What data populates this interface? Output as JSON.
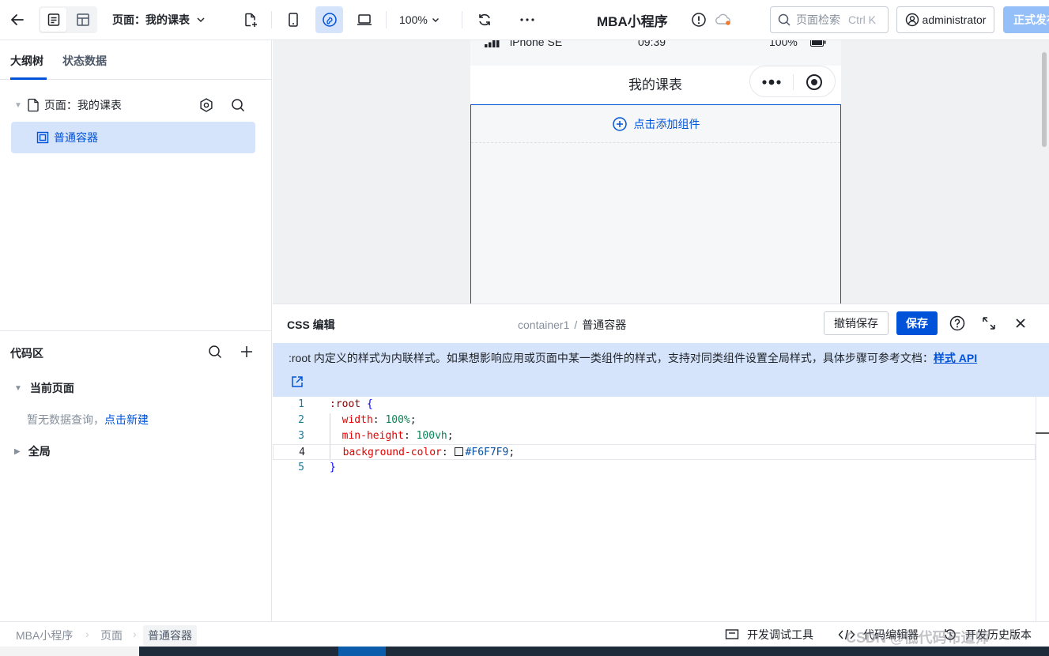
{
  "topbar": {
    "page_label": "页面：我的课表",
    "zoom": "100%",
    "app_title": "MBA小程序",
    "search_placeholder": "页面检索",
    "search_shortcut": "Ctrl K",
    "user": "administrator",
    "publish_label": "正式发布"
  },
  "left_tabs": {
    "outline": "大纲树",
    "state": "状态数据"
  },
  "tree": {
    "page_node": "页面：我的课表",
    "container_node": "普通容器"
  },
  "code_area": {
    "title": "代码区",
    "current_page": "当前页面",
    "empty_text": "暂无数据查询，",
    "create_link": "点击新建",
    "global": "全局"
  },
  "phone": {
    "device_name": "iPhone SE",
    "time": "09:39",
    "battery": "100%",
    "nav_title": "我的课表",
    "add_component": "点击添加组件"
  },
  "css_editor": {
    "title": "CSS 编辑",
    "breadcrumb_parent": "container1",
    "breadcrumb_current": "普通容器",
    "revert_label": "撤销保存",
    "save_label": "保存",
    "notice": ":root 内定义的样式为内联样式。如果想影响应用或页面中某一类组件的样式，支持对同类组件设置全局样式，具体步骤可参考文档：",
    "notice_link": "样式 API",
    "code": {
      "selector": ":root",
      "open_brace": "{",
      "close_brace": "}",
      "width_prop": "width",
      "width_val": "100%",
      "minh_prop": "min-height",
      "minh_val": "100vh",
      "bg_prop": "background-color",
      "bg_val": "#F6F7F9",
      "line_numbers": [
        "1",
        "2",
        "3",
        "4",
        "5"
      ]
    }
  },
  "footer": {
    "bc_app": "MBA小程序",
    "bc_page": "页面",
    "bc_current": "普通容器",
    "debug_tools": "开发调试工具",
    "code_editor": "代码编辑器",
    "history": "开发历史版本",
    "watermark": "CSDN @低代码布道师"
  },
  "colors": {
    "primary": "#0052d9",
    "selected_bg": "#d6e4fb",
    "publish_disabled": "#94bff8",
    "canvas_bg": "#f0f1f3",
    "page_bg": "#F6F7F9"
  }
}
